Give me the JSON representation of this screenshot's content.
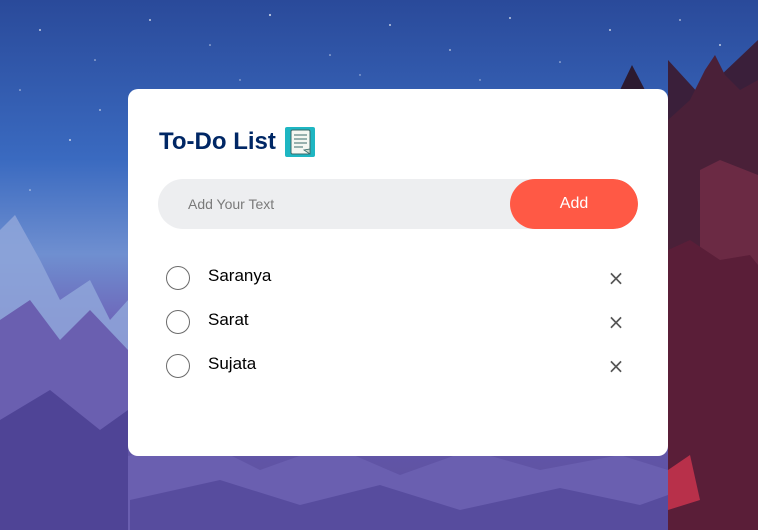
{
  "app": {
    "title": "To-Do List",
    "title_icon": "notepad-icon"
  },
  "input": {
    "placeholder": "Add Your Text",
    "value": ""
  },
  "add_button": {
    "label": "Add"
  },
  "tasks": [
    {
      "text": "Saranya",
      "checked": false,
      "remove_icon": "×"
    },
    {
      "text": "Sarat",
      "checked": false,
      "remove_icon": "×"
    },
    {
      "text": "Sujata",
      "checked": false,
      "remove_icon": "×"
    }
  ],
  "colors": {
    "accent": "#ff5945",
    "title": "#002765",
    "input_bg": "#edeef0",
    "card_bg": "#ffffff"
  }
}
